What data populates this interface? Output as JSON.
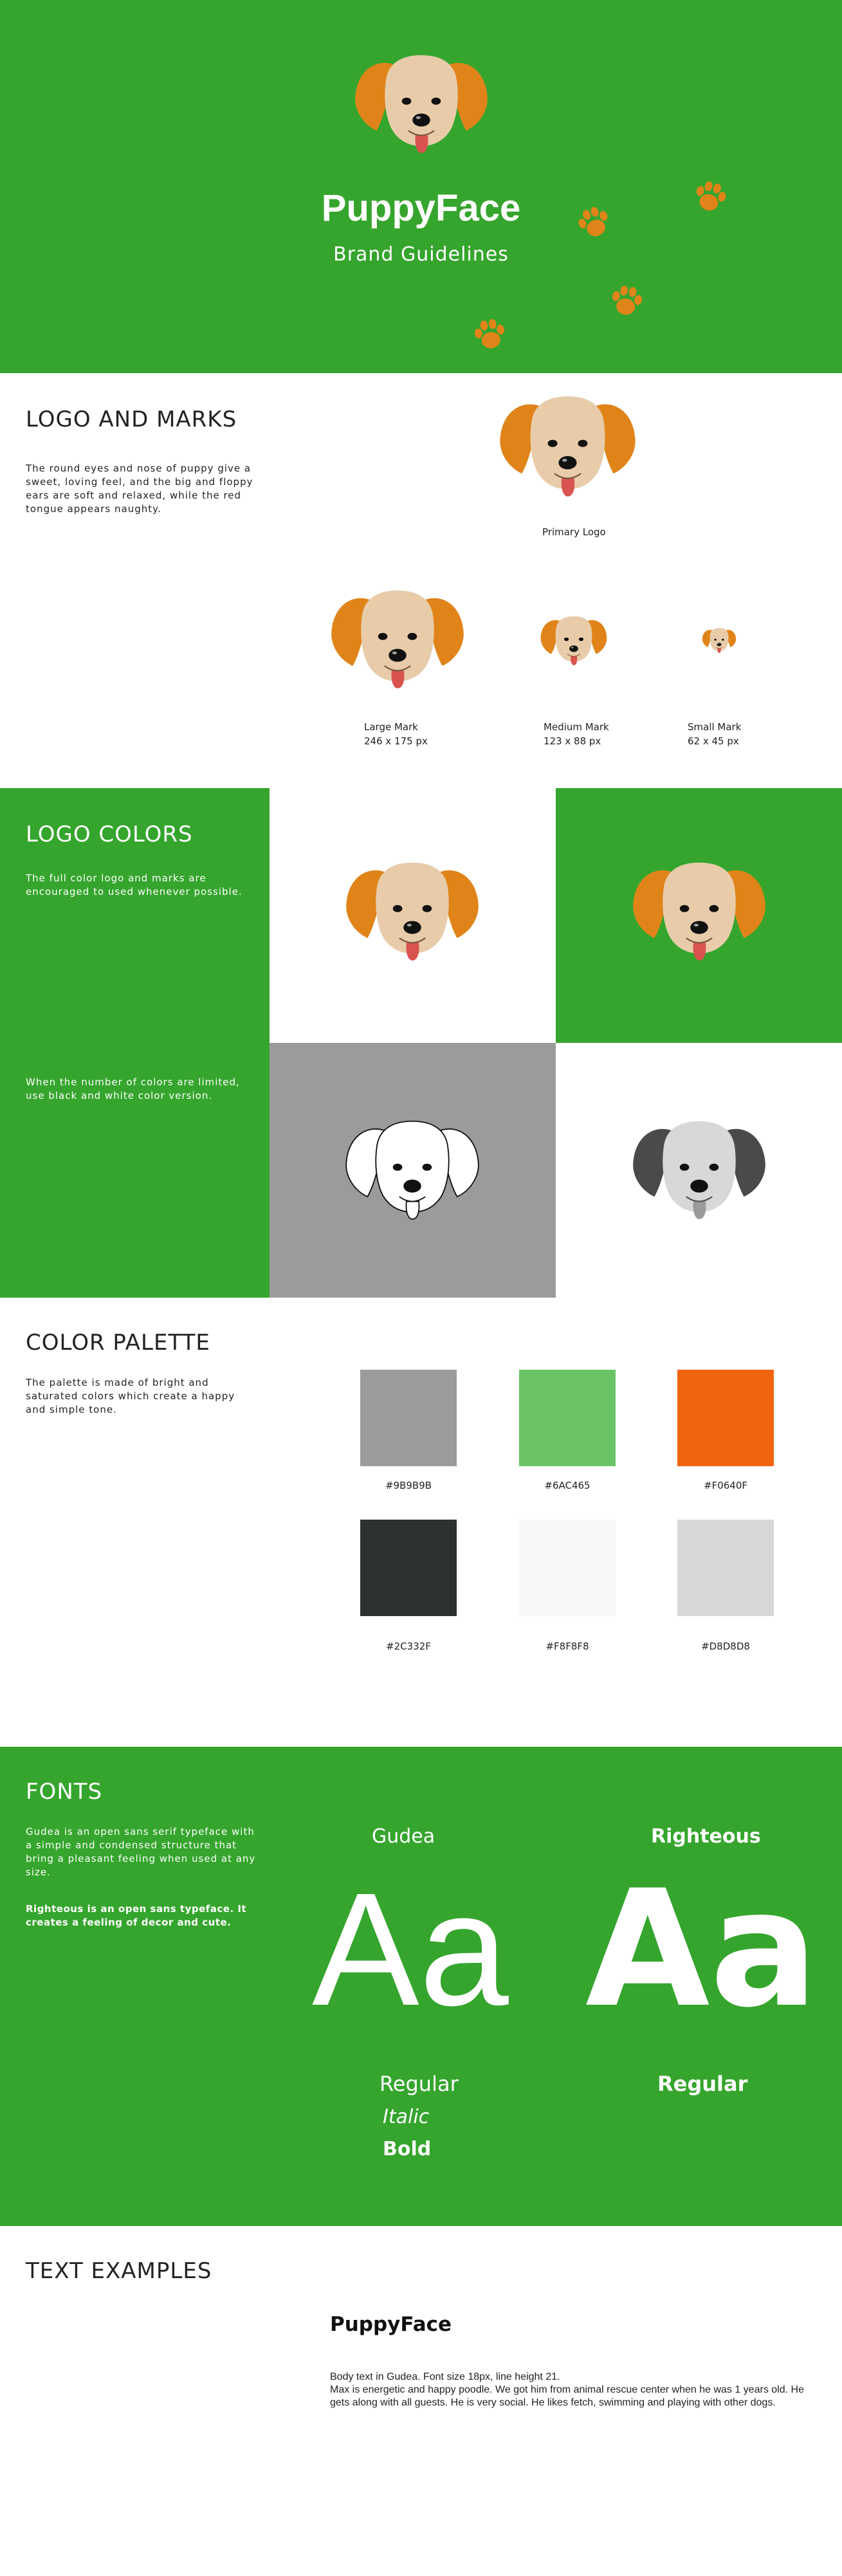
{
  "hero": {
    "title": "PuppyFace",
    "subtitle": "Brand Guidelines"
  },
  "logo_marks": {
    "title": "LOGO AND MARKS",
    "description": "The round eyes and nose of puppy give a sweet, loving feel, and the big and floppy ears are soft and relaxed, while the red tongue appears naughty.",
    "primary_label": "Primary Logo",
    "marks": [
      {
        "name": "Large Mark",
        "size": "246 x 175 px"
      },
      {
        "name": "Medium Mark",
        "size": "123 x 88 px"
      },
      {
        "name": "Small Mark",
        "size": "62 x 45 px"
      }
    ]
  },
  "logo_colors": {
    "title": "LOGO COLORS",
    "full_color_text": "The full color logo and marks are encouraged to used whenever possible.",
    "limited_text": "When the number of colors are limited, use black and white color version."
  },
  "palette": {
    "title": "COLOR PALETTE",
    "description": "The palette is made of bright and saturated colors which create a happy and simple tone.",
    "colors": [
      {
        "hex": "#9B9B9B",
        "label": "#9B9B9B"
      },
      {
        "hex": "#6AC465",
        "label": "#6AC465"
      },
      {
        "hex": "#F0640F",
        "label": "#F0640F"
      },
      {
        "hex": "#2C332F",
        "label": "#2C332F"
      },
      {
        "hex": "#F8F8F8",
        "label": "#F8F8F8"
      },
      {
        "hex": "#D8D8D8",
        "label": "#D8D8D8"
      }
    ]
  },
  "fonts": {
    "title": "FONTS",
    "gudea_text": "Gudea is an open sans serif typeface with a simple and condensed structure that bring a pleasant feeling when used at any size.",
    "righteous_text": "Righteous is an open sans typeface. It creates a feeling of decor and cute.",
    "font1_name": "Gudea",
    "font1_sample": "Aa",
    "font1_styles": [
      "Regular",
      "Italic",
      "Bold"
    ],
    "font2_name": "Righteous",
    "font2_sample": "Aa",
    "font2_style": "Regular"
  },
  "text_examples": {
    "title": "TEXT EXAMPLES",
    "brand": "PuppyFace",
    "body_line1": "Body text in Gudea. Font size 18px, line height 21.",
    "body_line2": "Max is energetic and happy poodle. We got him from animal rescue center when he was 1 years old. He gets along with all guests. He is very social. He likes fetch, swimming and playing with other dogs."
  },
  "colors": {
    "green": "#35a52d",
    "ear_orange": "#e0841a",
    "face": "#e8ccaa",
    "tongue": "#d9534f",
    "grey_panel": "#9b9b9b"
  }
}
